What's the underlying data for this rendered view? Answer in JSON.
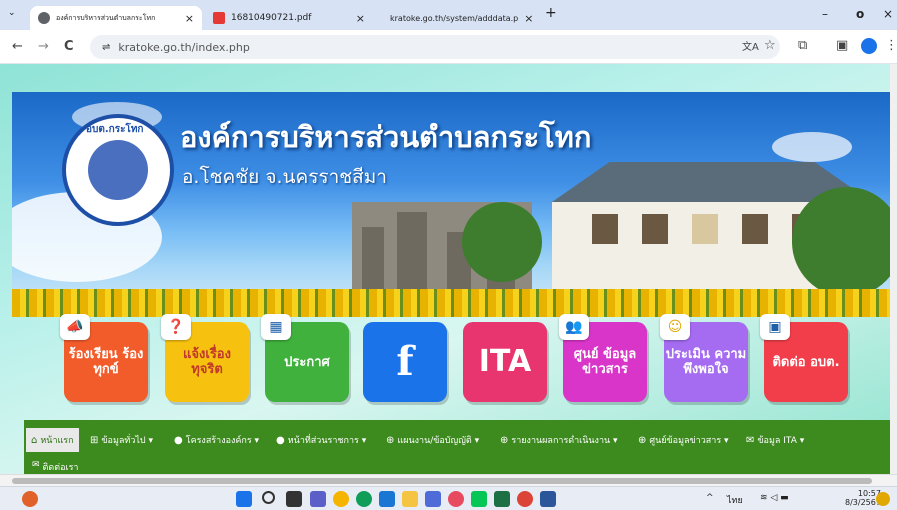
{
  "browser": {
    "tabs": [
      {
        "title": "องค์การบริหารส่วนตำบลกระโทก",
        "close": "×"
      },
      {
        "title": "16810490721.pdf",
        "close": "×"
      },
      {
        "title": "kratoke.go.th/system/adddata.p",
        "close": "×"
      }
    ],
    "new_tab": "+",
    "window": {
      "minimize": "–",
      "restore": "o",
      "close": "×"
    },
    "nav": {
      "back": "←",
      "forward": "→",
      "reload": "C"
    },
    "url": "kratoke.go.th/index.php",
    "site_info_icon": "⇌"
  },
  "banner": {
    "title": "องค์การบริหารส่วนตำบลกระโทก",
    "subtitle": "อ.โชคชัย จ.นครราชสีมา",
    "seal_text": "อบต.กระโทก"
  },
  "icon_buttons": [
    {
      "label": "ร้องเรียน ร้องทุกข์",
      "color": "#f25c2a"
    },
    {
      "label": "แจ้งเรื่อง ทุจริต",
      "color": "#f6c20f"
    },
    {
      "label": "ประกาศ",
      "color": "#3fb13c"
    },
    {
      "label": "f",
      "color": "#1877f2"
    },
    {
      "label": "ITA",
      "color": "#e8356f"
    },
    {
      "label": "ศูนย์ ข้อมูล ข่าวสาร",
      "color": "#d935c9"
    },
    {
      "label": "ประเมิน ความ พึงพอใจ",
      "color": "#a56bf0"
    },
    {
      "label": "ติดต่อ อบต.",
      "color": "#f23e4a"
    }
  ],
  "menu": {
    "items": [
      {
        "label": "หน้าแรก",
        "icon": "home-icon"
      },
      {
        "label": "ข้อมูลทั่วไป ▾",
        "icon": "sitemap-icon"
      },
      {
        "label": "โครงสร้างองค์กร ▾",
        "icon": "user-icon"
      },
      {
        "label": "หน้าที่ส่วนราชการ ▾",
        "icon": "user-icon"
      },
      {
        "label": "แผนงาน/ข้อบัญญัติ ▾",
        "icon": "search-icon"
      },
      {
        "label": "รายงานผลการดำเนินงาน ▾",
        "icon": "search-icon"
      },
      {
        "label": "ศูนย์ข้อมูลข่าวสาร ▾",
        "icon": "search-icon"
      },
      {
        "label": "ข้อมูล ITA ▾",
        "icon": "mail-icon"
      }
    ],
    "second_row": "ติดต่อเรา"
  },
  "taskbar": {
    "lang": "ไทย",
    "time": "10:57",
    "date": "8/3/2567"
  },
  "colors": {
    "menu_green": "#3d8a1f",
    "tab_bar": "#d7e3f5"
  }
}
